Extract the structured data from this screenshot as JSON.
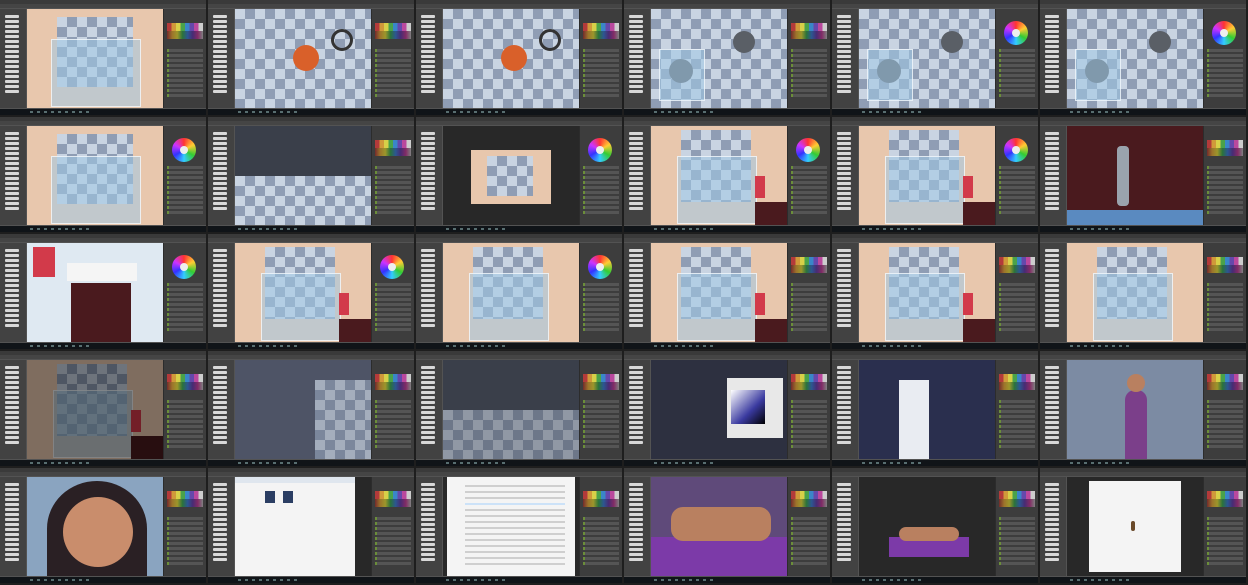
{
  "sheet": {
    "rows": 5,
    "columns": 6,
    "app": "image editor",
    "frames": [
      {
        "scene": "shower-wide"
      },
      {
        "scene": "showerhead-orange"
      },
      {
        "scene": "showerhead-closeup"
      },
      {
        "scene": "showerhead-grey"
      },
      {
        "scene": "showerhead-grey-multi"
      },
      {
        "scene": "showerhead-grey-multi-2"
      },
      {
        "scene": "shower-stall"
      },
      {
        "scene": "tiles-crop"
      },
      {
        "scene": "bathroom-small"
      },
      {
        "scene": "bathroom-wide"
      },
      {
        "scene": "bathroom-towel"
      },
      {
        "scene": "sink-pipe"
      },
      {
        "scene": "sink-towel"
      },
      {
        "scene": "bathroom-full"
      },
      {
        "scene": "shower-closeup"
      },
      {
        "scene": "bathroom-full-2"
      },
      {
        "scene": "bathroom-full-3"
      },
      {
        "scene": "shower-corner"
      },
      {
        "scene": "bathroom-dark"
      },
      {
        "scene": "room-dark-wall"
      },
      {
        "scene": "tiles-dark"
      },
      {
        "scene": "color-picker"
      },
      {
        "scene": "door-blue-wall"
      },
      {
        "scene": "character-nurse"
      },
      {
        "scene": "character-face"
      },
      {
        "scene": "file-dialog"
      },
      {
        "scene": "file-list"
      },
      {
        "scene": "character-couch"
      },
      {
        "scene": "character-couch-small"
      },
      {
        "scene": "blank-canvas"
      }
    ]
  },
  "colors": {
    "workspace": "#535353",
    "panel": "#3d3d3d",
    "taskbar": "#101418",
    "tile_light": "#c9d4e2",
    "tile_dark": "#8f9db4",
    "wall": "#e8c7ad",
    "accent_layer": "#6b8e3a"
  }
}
